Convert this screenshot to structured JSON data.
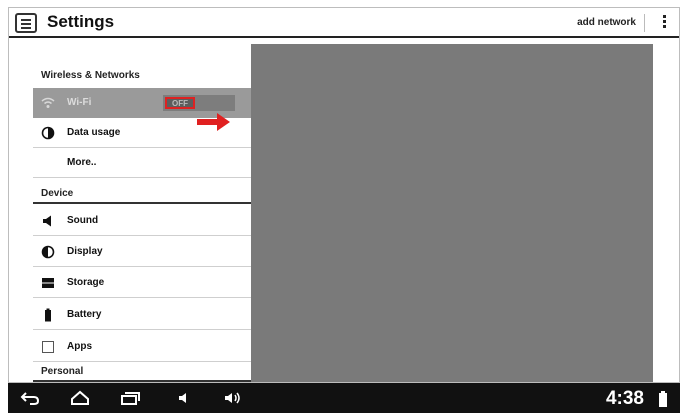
{
  "actionbar": {
    "icon": "settings-list-icon",
    "title": "Settings",
    "add_network": "add network",
    "overflow_icon": "overflow-menu-icon"
  },
  "sections": {
    "wireless": "Wireless & Networks",
    "device": "Device",
    "personal": "Personal"
  },
  "items": {
    "wifi": {
      "label": "Wi-Fi",
      "icon": "wifi-icon",
      "toggle_label": "OFF",
      "state": "off"
    },
    "data_usage": {
      "label": "Data usage",
      "icon": "data-usage-icon"
    },
    "more": {
      "label": "More.."
    },
    "sound": {
      "label": "Sound",
      "icon": "speaker-icon"
    },
    "display": {
      "label": "Display",
      "icon": "brightness-icon"
    },
    "storage": {
      "label": "Storage",
      "icon": "storage-icon"
    },
    "battery": {
      "label": "Battery",
      "icon": "battery-icon"
    },
    "apps": {
      "label": "Apps",
      "icon": "apps-icon"
    }
  },
  "navbar": {
    "icons": [
      "back-icon",
      "home-icon",
      "recent-apps-icon",
      "volume-down-icon",
      "volume-up-icon"
    ],
    "time": "4:38"
  },
  "colors": {
    "annotation": "#e02020",
    "navbar_bg": "#111111",
    "detail_pane": "#7a7a7a",
    "wifi_row_selected": "#9a9a9a"
  }
}
